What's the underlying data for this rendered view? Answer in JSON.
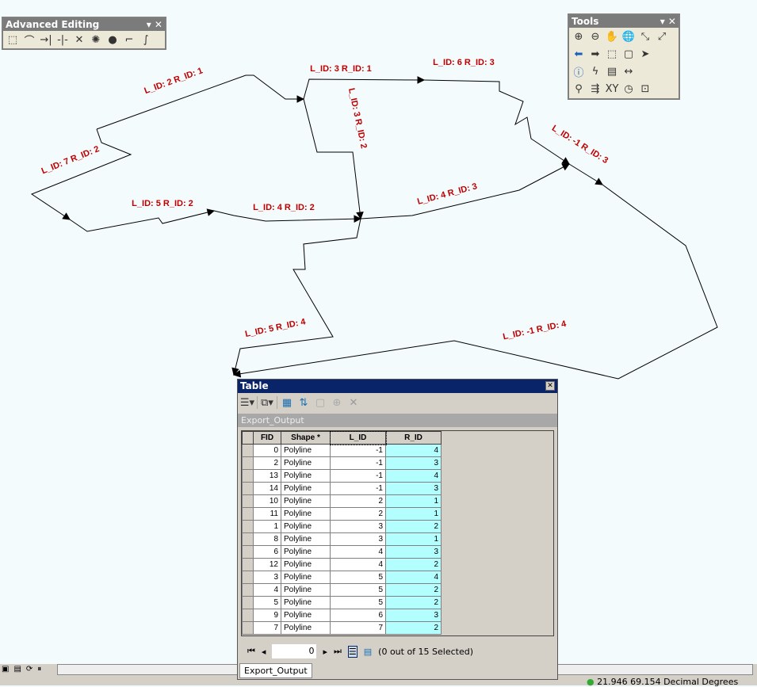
{
  "toolbars": {
    "advanced_editing": {
      "title": "Advanced Editing",
      "icons": [
        "copy-features-icon",
        "fillet-icon",
        "extend-icon",
        "trim-icon",
        "line-intersection-icon",
        "explode-icon",
        "generalize-icon",
        "align-to-shape-icon",
        "smooth-icon"
      ]
    },
    "tools": {
      "title": "Tools",
      "rows": [
        [
          "zoom-in-icon",
          "zoom-out-icon",
          "pan-icon",
          "full-extent-icon",
          "fixed-zoom-in-icon",
          "fixed-zoom-out-icon"
        ],
        [
          "back-icon",
          "forward-icon",
          "select-features-icon",
          "clear-selection-icon",
          "select-elements-icon"
        ],
        [
          "identify-icon",
          "hyperlink-icon",
          "html-popup-icon",
          "measure-icon"
        ],
        [
          "find-icon",
          "find-route-icon",
          "go-to-xy-icon",
          "time-slider-icon",
          "magnifier-icon"
        ]
      ]
    }
  },
  "map": {
    "line_color": "#000000",
    "label_color": "#c00000",
    "labels": [
      "L_ID: 2 R_ID: 1",
      "L_ID: 3 R_ID: 1",
      "L_ID: 6 R_ID: 3",
      "L_ID: 7 R_ID: 2",
      "L_ID: 3 R_ID: 2",
      "L_ID: -1 R_ID: 3",
      "L_ID: 5 R_ID: 2",
      "L_ID: 4 R_ID: 2",
      "L_ID: 4 R_ID: 3",
      "L_ID: 5 R_ID: 4",
      "L_ID: -1 R_ID: 4"
    ]
  },
  "table": {
    "title": "Table",
    "tab": "Export_Output",
    "columns": [
      "FID",
      "Shape *",
      "L_ID",
      "R_ID"
    ],
    "rows": [
      [
        "0",
        "Polyline",
        "-1",
        "4"
      ],
      [
        "2",
        "Polyline",
        "-1",
        "3"
      ],
      [
        "13",
        "Polyline",
        "-1",
        "4"
      ],
      [
        "14",
        "Polyline",
        "-1",
        "3"
      ],
      [
        "10",
        "Polyline",
        "2",
        "1"
      ],
      [
        "11",
        "Polyline",
        "2",
        "1"
      ],
      [
        "1",
        "Polyline",
        "3",
        "2"
      ],
      [
        "8",
        "Polyline",
        "3",
        "1"
      ],
      [
        "6",
        "Polyline",
        "4",
        "3"
      ],
      [
        "12",
        "Polyline",
        "4",
        "2"
      ],
      [
        "3",
        "Polyline",
        "5",
        "4"
      ],
      [
        "4",
        "Polyline",
        "5",
        "2"
      ],
      [
        "5",
        "Polyline",
        "5",
        "2"
      ],
      [
        "9",
        "Polyline",
        "6",
        "3"
      ],
      [
        "7",
        "Polyline",
        "7",
        "2"
      ]
    ],
    "record": "0",
    "selection": "(0 out of 15 Selected)",
    "bottom_tab": "Export_Output"
  },
  "status": {
    "coords": "21.946 69.154 Decimal Degrees"
  }
}
